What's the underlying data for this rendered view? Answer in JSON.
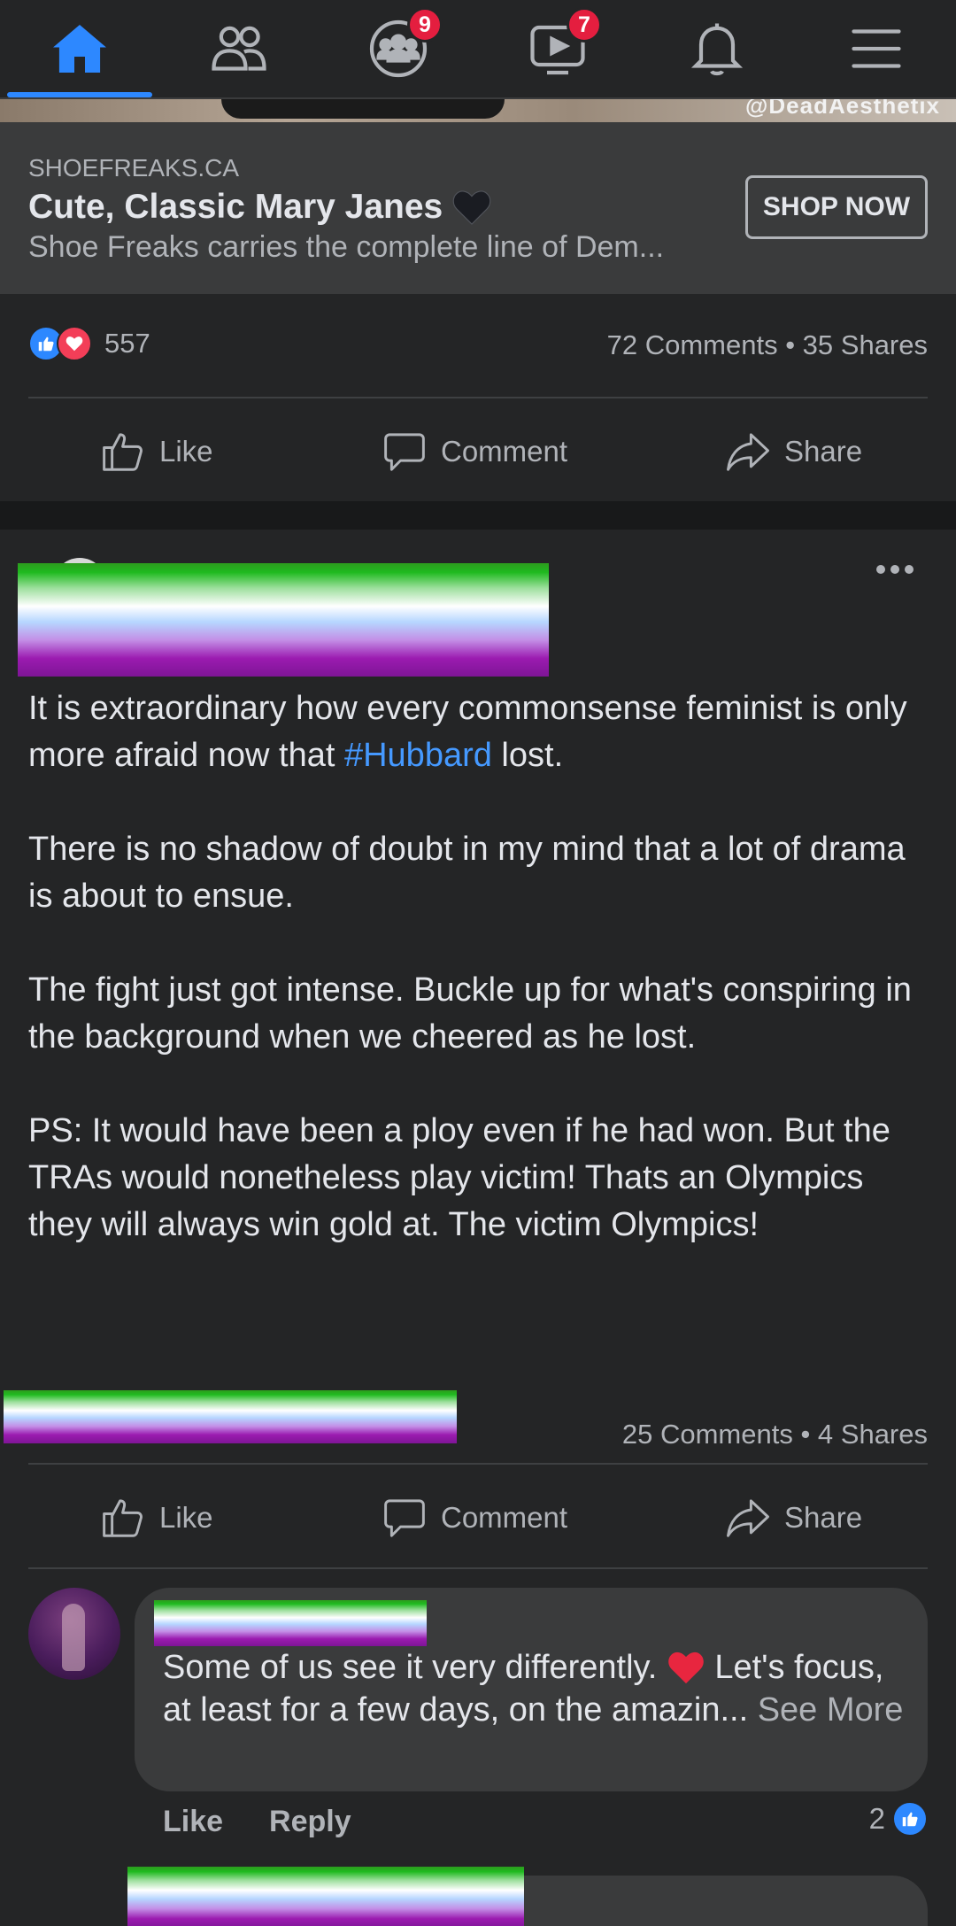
{
  "nav": {
    "tabs": [
      {
        "name": "home",
        "active": true
      },
      {
        "name": "friends"
      },
      {
        "name": "groups",
        "badge": "9"
      },
      {
        "name": "watch",
        "badge": "7"
      },
      {
        "name": "notifications"
      },
      {
        "name": "menu"
      }
    ]
  },
  "colors": {
    "accent": "#2d88ff",
    "badge": "#e41e3f",
    "background": "#18191a",
    "card": "#242526",
    "hashtag": "#4599ff"
  },
  "image_watermark": "@DeadAesthetix",
  "ad": {
    "domain": "SHOEFREAKS.CA",
    "title": "Cute, Classic Mary Janes",
    "description": "Shoe Freaks carries the complete line of Dem...",
    "cta": "SHOP NOW"
  },
  "post1": {
    "reaction_count": "557",
    "stats": "72 Comments • 35 Shares",
    "actions": {
      "like": "Like",
      "comment": "Comment",
      "share": "Share"
    }
  },
  "post2": {
    "paragraphs": {
      "p1_before": "It is extraordinary how every commonsense feminist is only more afraid now that ",
      "p1_hashtag": "#Hubbard",
      "p1_after": " lost.",
      "p2": "There is no shadow of doubt in my mind that a lot of drama is about to ensue.",
      "p3": "The fight just got intense. Buckle up for what's conspiring in the background when we cheered as he lost.",
      "p4": "PS: It would have been a ploy even if he had won. But the TRAs would nonetheless play victim! Thats an Olympics they will always win gold at. The victim Olympics!"
    },
    "stats": "25 Comments • 4 Shares",
    "actions": {
      "like": "Like",
      "comment": "Comment",
      "share": "Share"
    },
    "comment": {
      "text_before": "Some of us see it very differently. ",
      "text_after": " Let's focus, at least for a few days, on the amazin...",
      "see_more": "See More",
      "like": "Like",
      "reply": "Reply",
      "reaction_count": "2"
    }
  }
}
